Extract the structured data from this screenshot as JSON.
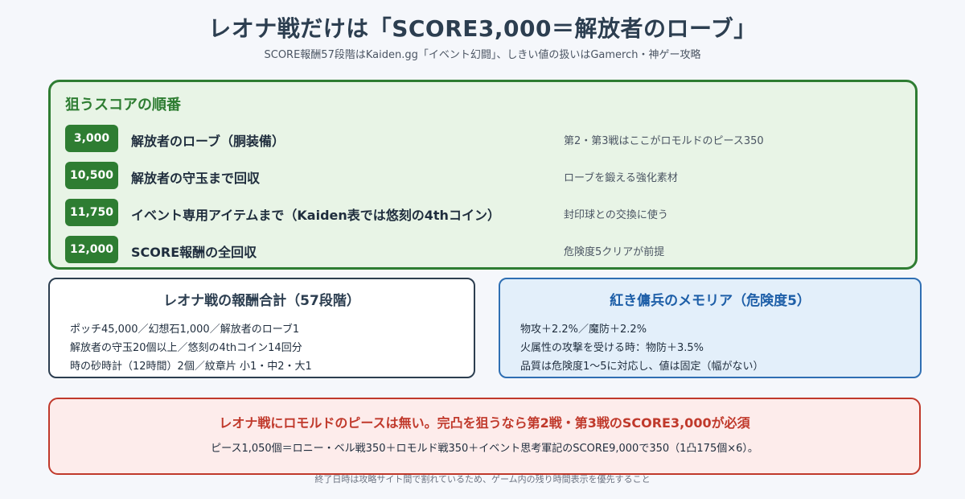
{
  "header": {
    "title": "レオナ戦だけは「SCORE3,000＝解放者のローブ」",
    "subtitle": "SCORE報酬57段階はKaiden.gg「イベント幻闘」、しきい値の扱いはGamerch・神ゲー攻略"
  },
  "targets": {
    "heading": "狙うスコアの順番",
    "rows": [
      {
        "score": "3,000",
        "label": "解放者のローブ（胴装備）",
        "note": "第2・第3戦はここがロモルドのピース350"
      },
      {
        "score": "10,500",
        "label": "解放者の守玉まで回収",
        "note": "ローブを鍛える強化素材"
      },
      {
        "score": "11,750",
        "label": "イベント専用アイテムまで（Kaiden表では悠刻の4thコイン）",
        "note": "封印球との交換に使う"
      },
      {
        "score": "12,000",
        "label": "SCORE報酬の全回収",
        "note": "危険度5クリアが前提"
      }
    ]
  },
  "rewards": {
    "heading": "レオナ戦の報酬合計（57段階）",
    "lines": [
      "ポッチ45,000／幻想石1,000／解放者のローブ1",
      "解放者の守玉20個以上／悠刻の4thコイン14回分",
      "時の砂時計（12時間）2個／紋章片 小1・中2・大1"
    ]
  },
  "memoria": {
    "heading": "紅き傭兵のメモリア（危険度5）",
    "lines": [
      "物攻＋2.2%／魔防＋2.2%",
      "火属性の攻撃を受ける時：物防＋3.5%",
      "品質は危険度1〜5に対応し、値は固定（幅がない）"
    ]
  },
  "warning": {
    "heading": "レオナ戦にロモルドのピースは無い。完凸を狙うなら第2戦・第3戦のSCORE3,000が必須",
    "body": "ピース1,050個＝ロニー・ベル戦350＋ロモルド戦350＋イベント思考軍記のSCORE9,000で350（1凸175個×6）。"
  },
  "footnote": "終了日時は攻略サイト間で割れているため、ゲーム内の残り時間表示を優先すること"
}
